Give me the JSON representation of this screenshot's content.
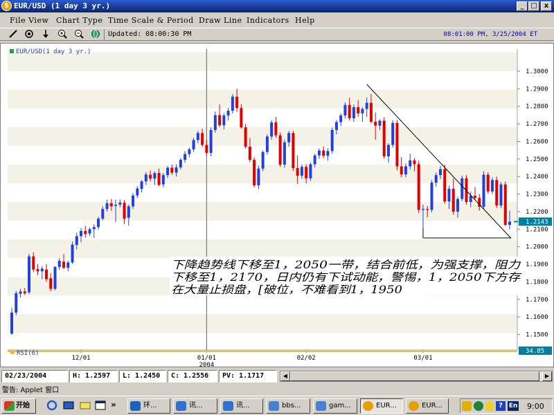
{
  "window": {
    "title": "EUR/USD (1 day  3 yr.)",
    "icon": "currency-icon",
    "controls": [
      "_",
      "▫",
      "x"
    ]
  },
  "menu": [
    "File View",
    "Chart Type",
    "Time Scale & Period",
    "Draw Line",
    "Indicators",
    "Help"
  ],
  "toolbar": {
    "icons": [
      "draw-line-icon",
      "target-icon",
      "arrow-down-icon",
      "zoom-in-icon",
      "zoom-out-icon",
      "globe-icon"
    ],
    "updated": "Updated: 08:00:30 PM",
    "clock": "08:01:00 PM, 3/25/2004 ET"
  },
  "chart_data": {
    "type": "candlestick",
    "legend_label": "EUR/USD(1 day  3 yr.)",
    "y_ticks": [
      "1.3000",
      "1.2900",
      "1.2800",
      "1.2700",
      "1.2600",
      "1.2500",
      "1.2400",
      "1.2300",
      "1.2200",
      "1.2100",
      "1.2000",
      "1.1900",
      "1.1800",
      "1.1700",
      "1.1600",
      "1.1500"
    ],
    "ylim": [
      1.1455,
      1.3055
    ],
    "x_ticks": [
      {
        "label": "12/01",
        "index": 16
      },
      {
        "label": "01/01",
        "sub": "2004",
        "index": 45
      },
      {
        "label": "02/02",
        "index": 68
      },
      {
        "label": "03/01",
        "index": 95
      }
    ],
    "last_price": "1.2143",
    "rsi_label": "RSI(6)",
    "rsi_value": "34.85",
    "candles": [
      [
        1.1505,
        1.1652,
        1.1498,
        1.1625
      ],
      [
        1.1625,
        1.1748,
        1.161,
        1.1735
      ],
      [
        1.1732,
        1.176,
        1.1712,
        1.1745
      ],
      [
        1.1745,
        1.1765,
        1.1725,
        1.1735
      ],
      [
        1.174,
        1.196,
        1.173,
        1.1945
      ],
      [
        1.1945,
        1.1968,
        1.1855,
        1.187
      ],
      [
        1.1872,
        1.1902,
        1.1838,
        1.186
      ],
      [
        1.186,
        1.189,
        1.1815,
        1.1875
      ],
      [
        1.187,
        1.19,
        1.18,
        1.1815
      ],
      [
        1.182,
        1.185,
        1.1745,
        1.176
      ],
      [
        1.176,
        1.189,
        1.1752,
        1.1885
      ],
      [
        1.1885,
        1.1935,
        1.1868,
        1.192
      ],
      [
        1.1915,
        1.1958,
        1.1872,
        1.188
      ],
      [
        1.188,
        1.192,
        1.186,
        1.191
      ],
      [
        1.191,
        1.203,
        1.1902,
        1.2012
      ],
      [
        1.201,
        1.208,
        1.1985,
        1.206
      ],
      [
        1.206,
        1.2105,
        1.2025,
        1.209
      ],
      [
        1.209,
        1.2118,
        1.2052,
        1.2072
      ],
      [
        1.2075,
        1.211,
        1.206,
        1.21
      ],
      [
        1.21,
        1.2128,
        1.205,
        1.2112
      ],
      [
        1.2112,
        1.217,
        1.2098,
        1.216
      ],
      [
        1.216,
        1.223,
        1.215,
        1.2215
      ],
      [
        1.2215,
        1.2268,
        1.22,
        1.2248
      ],
      [
        1.2248,
        1.2272,
        1.2205,
        1.223
      ],
      [
        1.2232,
        1.2268,
        1.214,
        1.2238
      ],
      [
        1.224,
        1.227,
        1.2225,
        1.2252
      ],
      [
        1.225,
        1.2265,
        1.213,
        1.216
      ],
      [
        1.2165,
        1.224,
        1.212,
        1.223
      ],
      [
        1.223,
        1.2305,
        1.2215,
        1.2292
      ],
      [
        1.2292,
        1.2345,
        1.2278,
        1.2332
      ],
      [
        1.233,
        1.238,
        1.231,
        1.2372
      ],
      [
        1.2372,
        1.2425,
        1.2352,
        1.2412
      ],
      [
        1.241,
        1.2435,
        1.2372,
        1.2388
      ],
      [
        1.2388,
        1.243,
        1.2352,
        1.242
      ],
      [
        1.242,
        1.2445,
        1.2345,
        1.2352
      ],
      [
        1.2355,
        1.242,
        1.2338,
        1.2408
      ],
      [
        1.2408,
        1.246,
        1.2392,
        1.245
      ],
      [
        1.245,
        1.2468,
        1.241,
        1.2422
      ],
      [
        1.2422,
        1.247,
        1.24,
        1.2452
      ],
      [
        1.2452,
        1.2505,
        1.244,
        1.2495
      ],
      [
        1.2495,
        1.2545,
        1.2478,
        1.2528
      ],
      [
        1.2528,
        1.2565,
        1.251,
        1.2555
      ],
      [
        1.2555,
        1.262,
        1.254,
        1.2608
      ],
      [
        1.2608,
        1.266,
        1.259,
        1.2648
      ],
      [
        1.2648,
        1.2672,
        1.2568,
        1.258
      ],
      [
        1.258,
        1.261,
        1.252,
        1.2535
      ],
      [
        1.2535,
        1.268,
        1.2515,
        1.2665
      ],
      [
        1.2665,
        1.277,
        1.265,
        1.275
      ],
      [
        1.275,
        1.281,
        1.2682,
        1.2692
      ],
      [
        1.2692,
        1.276,
        1.2668,
        1.2748
      ],
      [
        1.2748,
        1.279,
        1.272,
        1.2775
      ],
      [
        1.2775,
        1.287,
        1.276,
        1.2855
      ],
      [
        1.2855,
        1.29,
        1.2768,
        1.279
      ],
      [
        1.279,
        1.2812,
        1.2672,
        1.268
      ],
      [
        1.268,
        1.27,
        1.2558,
        1.257
      ],
      [
        1.257,
        1.262,
        1.2482,
        1.2495
      ],
      [
        1.2495,
        1.251,
        1.2338,
        1.235
      ],
      [
        1.235,
        1.2462,
        1.2328,
        1.2445
      ],
      [
        1.2445,
        1.2548,
        1.243,
        1.254
      ],
      [
        1.254,
        1.264,
        1.2525,
        1.2628
      ],
      [
        1.2628,
        1.272,
        1.261,
        1.2708
      ],
      [
        1.2708,
        1.274,
        1.262,
        1.2635
      ],
      [
        1.2635,
        1.265,
        1.2455,
        1.2468
      ],
      [
        1.2468,
        1.261,
        1.245,
        1.2595
      ],
      [
        1.2595,
        1.266,
        1.257,
        1.2648
      ],
      [
        1.2648,
        1.266,
        1.2432,
        1.2448
      ],
      [
        1.2448,
        1.252,
        1.2358,
        1.2405
      ],
      [
        1.2405,
        1.2468,
        1.2388,
        1.2455
      ],
      [
        1.2455,
        1.247,
        1.2362,
        1.239
      ],
      [
        1.239,
        1.248,
        1.2375,
        1.247
      ],
      [
        1.247,
        1.253,
        1.2452,
        1.252
      ],
      [
        1.252,
        1.256,
        1.25,
        1.2548
      ],
      [
        1.2548,
        1.2572,
        1.2505,
        1.2518
      ],
      [
        1.2518,
        1.256,
        1.249,
        1.2545
      ],
      [
        1.2545,
        1.268,
        1.253,
        1.2665
      ],
      [
        1.2665,
        1.2722,
        1.264,
        1.271
      ],
      [
        1.271,
        1.276,
        1.2688,
        1.2748
      ],
      [
        1.2748,
        1.2822,
        1.273,
        1.2808
      ],
      [
        1.2808,
        1.2848,
        1.272,
        1.2732
      ],
      [
        1.2732,
        1.281,
        1.2712,
        1.2795
      ],
      [
        1.2795,
        1.2835,
        1.274,
        1.276
      ],
      [
        1.276,
        1.2795,
        1.2712,
        1.2785
      ],
      [
        1.2785,
        1.285,
        1.274,
        1.282
      ],
      [
        1.282,
        1.287,
        1.2702,
        1.2712
      ],
      [
        1.2712,
        1.2765,
        1.261,
        1.269
      ],
      [
        1.269,
        1.2725,
        1.2665,
        1.2718
      ],
      [
        1.2718,
        1.2738,
        1.2502,
        1.2515
      ],
      [
        1.2515,
        1.259,
        1.2478,
        1.258
      ],
      [
        1.258,
        1.272,
        1.2565,
        1.2705
      ],
      [
        1.2705,
        1.2722,
        1.2435,
        1.2458
      ],
      [
        1.2458,
        1.251,
        1.2395,
        1.2412
      ],
      [
        1.2412,
        1.2475,
        1.2395,
        1.2458
      ],
      [
        1.2458,
        1.253,
        1.244,
        1.2492
      ],
      [
        1.2492,
        1.2505,
        1.243,
        1.247
      ],
      [
        1.247,
        1.249,
        1.2192,
        1.221
      ],
      [
        1.221,
        1.224,
        1.21,
        1.2215
      ],
      [
        1.2215,
        1.2232,
        1.2168,
        1.221
      ],
      [
        1.221,
        1.238,
        1.2195,
        1.2365
      ],
      [
        1.2365,
        1.2422,
        1.2342,
        1.2408
      ],
      [
        1.2408,
        1.246,
        1.2385,
        1.2442
      ],
      [
        1.2442,
        1.2468,
        1.2245,
        1.2258
      ],
      [
        1.2258,
        1.2348,
        1.2215,
        1.233
      ],
      [
        1.233,
        1.239,
        1.2182,
        1.22
      ],
      [
        1.22,
        1.2285,
        1.2165,
        1.2272
      ],
      [
        1.2272,
        1.2405,
        1.2258,
        1.239
      ],
      [
        1.239,
        1.2408,
        1.224,
        1.2255
      ],
      [
        1.2255,
        1.2315,
        1.2225,
        1.229
      ],
      [
        1.229,
        1.234,
        1.2268,
        1.2278
      ],
      [
        1.2278,
        1.23,
        1.2205,
        1.2228
      ],
      [
        1.2228,
        1.243,
        1.2215,
        1.241
      ],
      [
        1.241,
        1.2425,
        1.2302,
        1.2315
      ],
      [
        1.2315,
        1.2395,
        1.23,
        1.238
      ],
      [
        1.238,
        1.24,
        1.222,
        1.2235
      ],
      [
        1.2235,
        1.2368,
        1.222,
        1.2355
      ],
      [
        1.2355,
        1.2372,
        1.2118,
        1.2125
      ],
      [
        1.2125,
        1.2205,
        1.21,
        1.2143
      ]
    ],
    "annotation": {
      "lines": [
        "下降趋势线下移至1，2050一带，结合前低，为强支撑，阻力",
        "下移至1，2170，日内仍有下试动能，警惕，1，2050下方存",
        "在大量止损盘，[破位，不难看到1，1950"
      ]
    }
  },
  "status": {
    "date": "02/23/2004",
    "high": "H: 1.2597",
    "low": "L: 1.2450",
    "close": "C: 1.2556",
    "pv": "PV: 1.1717"
  },
  "warning": "警告: Applet 窗口",
  "taskbar": {
    "start": "开始",
    "quick_launch": [
      "ie-icon",
      "desktop-icon",
      "outlook-icon",
      "window-icon"
    ],
    "more": "»",
    "tasks": [
      {
        "label": "环...",
        "icon": "app-icon",
        "color": "#2060c0"
      },
      {
        "label": "讯...",
        "icon": "app-icon",
        "color": "#3070d0"
      },
      {
        "label": "讯...",
        "icon": "app-icon",
        "color": "#3070d0"
      },
      {
        "label": "bbs...",
        "icon": "app-icon",
        "color": "#4a80d0"
      },
      {
        "label": "gam...",
        "icon": "app-icon",
        "color": "#4a80d0"
      },
      {
        "label": "EUR...",
        "icon": "currency-icon",
        "color": "#e8a000"
      },
      {
        "label": "EUR...",
        "icon": "currency-icon",
        "color": "#e8a000"
      }
    ],
    "tray": {
      "clock": "9:00",
      "lang": "En"
    }
  },
  "colors": {
    "up": "#2040e0",
    "down": "#e00000",
    "band": "#f4f2e6",
    "accent_price": "#0080a0"
  }
}
